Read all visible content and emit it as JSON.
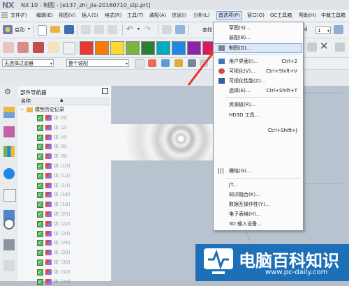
{
  "window": {
    "logo": "NX",
    "title": "NX 10 - 制图 - [e137_zhi_jia-20160710_stp.prt]"
  },
  "menubar": {
    "items": [
      {
        "label": "文件(F)"
      },
      {
        "label": "编辑(E)"
      },
      {
        "label": "视图(V)"
      },
      {
        "label": "插入(S)"
      },
      {
        "label": "格式(R)"
      },
      {
        "label": "工具(T)"
      },
      {
        "label": "装配(A)"
      },
      {
        "label": "信息(I)"
      },
      {
        "label": "分析(L)"
      },
      {
        "label": "首选项(P)"
      },
      {
        "label": "窗口(O)"
      },
      {
        "label": "GC工具箱"
      },
      {
        "label": "帮助(H)"
      },
      {
        "label": "中裁工具箱"
      }
    ]
  },
  "toolbar": {
    "start_label": "启动",
    "find_label": "查找",
    "find_suffix": "d",
    "number_field": "1"
  },
  "filterbar": {
    "selection_filter": "无选择过滤器",
    "scope": "整个装配"
  },
  "navigator": {
    "title": "部件导航器",
    "column_name": "名称",
    "root": "模型历史记录",
    "bodies": [
      "体 (0)",
      "体 (2)",
      "体 (4)",
      "体 (6)",
      "体 (8)",
      "体 (10)",
      "体 (12)",
      "体 (14)",
      "体 (16)",
      "体 (18)",
      "体 (20)",
      "体 (22)",
      "体 (24)",
      "体 (26)",
      "体 (28)",
      "体 (30)",
      "体 (32)",
      "体 (34)"
    ]
  },
  "prefs_menu": {
    "items": [
      {
        "label": "草图(S)...",
        "shortcut": ""
      },
      {
        "label": "装配(B)...",
        "shortcut": ""
      },
      {
        "label": "制图(D)...",
        "shortcut": ""
      },
      {
        "label": "用户界面(I)...",
        "shortcut": "Ctrl+2"
      },
      {
        "label": "可视化(V)...",
        "shortcut": "Ctrl+Shift+V"
      },
      {
        "label": "可视化性能(Z)...",
        "shortcut": ""
      },
      {
        "label": "选择(E)...",
        "shortcut": "Ctrl+Shift+T"
      },
      {
        "label": "资源板(R)...",
        "shortcut": ""
      },
      {
        "label": "HD3D 工具...",
        "shortcut": ""
      },
      {
        "label": "",
        "shortcut": "Ctrl+Shift+J"
      },
      {
        "label": "栅格(G)...",
        "shortcut": ""
      },
      {
        "label": "JT...",
        "shortcut": ""
      },
      {
        "label": "知识融合(K)...",
        "shortcut": ""
      },
      {
        "label": "数据互操作性(Y)...",
        "shortcut": ""
      },
      {
        "label": "电子表格(H)...",
        "shortcut": ""
      },
      {
        "label": "3D 输入设备...",
        "shortcut": ""
      }
    ]
  },
  "watermark": {
    "title": "电脑百科知识",
    "url": "www.pc-daily.com"
  },
  "colors": {
    "accent_blue": "#1d6fb8",
    "highlight": "#dbe8f6",
    "arrow_red": "#e8332b"
  }
}
